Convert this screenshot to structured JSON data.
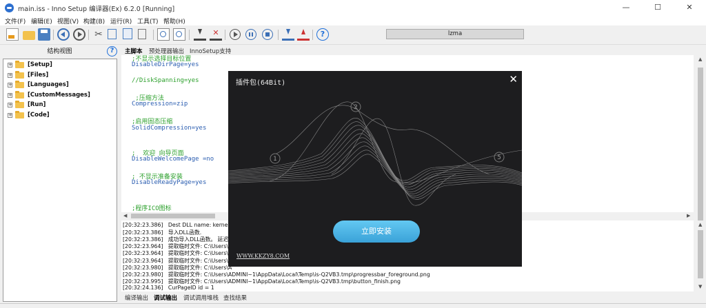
{
  "window": {
    "title": "main.iss - Inno Setup 编译器(Ex) 6.2.0  [Running]",
    "minimize": "—",
    "maximize": "☐",
    "close": "✕"
  },
  "menu": [
    "文件(F)",
    "编辑(E)",
    "视图(V)",
    "构建(B)",
    "运行(R)",
    "工具(T)",
    "帮助(H)"
  ],
  "toolbar": {
    "compiler_value": "lzma",
    "icons": [
      "new-file-icon",
      "open-folder-icon",
      "save-icon",
      "back-icon",
      "forward-icon",
      "cut-icon",
      "copy-icon",
      "paste-icon",
      "delete-icon",
      "find-icon",
      "find-replace-icon",
      "compile-icon",
      "stop-compile-icon",
      "run-icon",
      "pause-icon",
      "stop-icon",
      "step-into-icon",
      "step-out-icon",
      "help-icon"
    ]
  },
  "structure": {
    "header": "结构视图",
    "help": "?",
    "items": [
      "[Setup]",
      "[Files]",
      "[Languages]",
      "[CustomMessages]",
      "[Run]",
      "[Code]"
    ]
  },
  "editor_tabs": [
    "主脚本",
    "预处理器输出",
    "InnoSetup支持"
  ],
  "code_lines": [
    {
      "text": ";不显示选择目标位置",
      "kind": "comment"
    },
    {
      "text": "DisableDirPage=yes",
      "kind": "key"
    },
    {
      "text": "",
      "kind": "val"
    },
    {
      "text": "//DiskSpanning=yes",
      "kind": "comment"
    },
    {
      "text": "",
      "kind": "val"
    },
    {
      "text": " ;压缩方法",
      "kind": "comment"
    },
    {
      "text": "Compression=zip",
      "kind": "key"
    },
    {
      "text": "",
      "kind": "val"
    },
    {
      "text": ";启用固态压缩",
      "kind": "comment"
    },
    {
      "text": "SolidCompression=yes",
      "kind": "key"
    },
    {
      "text": "",
      "kind": "val"
    },
    {
      "text": "",
      "kind": "val"
    },
    {
      "text": ";  欢迎 向导页面",
      "kind": "comment"
    },
    {
      "text": "DisableWelcomePage =no",
      "kind": "key"
    },
    {
      "text": "",
      "kind": "val"
    },
    {
      "text": "; 不显示准备安装",
      "kind": "comment"
    },
    {
      "text": "DisableReadyPage=yes",
      "kind": "key"
    },
    {
      "text": "",
      "kind": "val"
    },
    {
      "text": "",
      "kind": "val"
    },
    {
      "text": ";程序ICO图标",
      "kind": "comment"
    }
  ],
  "log_lines": [
    "[20:32:23.386]   Dest DLL name: kernel32.d",
    "[20:32:23.386]   导入DLL函数.",
    "[20:32:23.386]   成功导入DLL函数。 延迟",
    "[20:32:23.964]   提取临时文件: C:\\Users\\A",
    "[20:32:23.964]   提取临时文件: C:\\Users\\A",
    "[20:32:23.964]   提取临时文件: C:\\Users\\A",
    "[20:32:23.980]   提取临时文件: C:\\Users\\A",
    "[20:32:23.980]   提取临时文件: C:\\Users\\ADMINI~1\\AppData\\Local\\Temp\\is-Q2VB3.tmp\\progressbar_foreground.png",
    "[20:32:23.995]   提取临时文件: C:\\Users\\ADMINI~1\\AppData\\Local\\Temp\\is-Q2VB3.tmp\\button_finish.png",
    "[20:32:24.136]   CurPageID id = 1"
  ],
  "bottom_tabs": [
    "编译输出",
    "调试输出",
    "调试调用堆栈",
    "查找结果"
  ],
  "dialog": {
    "title": "插件包(64Bit)",
    "close": "✕",
    "install_button": "立即安装",
    "link": "WWW.KKZY8.COM",
    "markers": [
      "1",
      "2",
      "5"
    ]
  },
  "colors": {
    "comment": "#2ca02c",
    "keyword": "#2a5db0",
    "dialog_bg": "#1d1d1f",
    "install_button": "#4bb4e6"
  }
}
